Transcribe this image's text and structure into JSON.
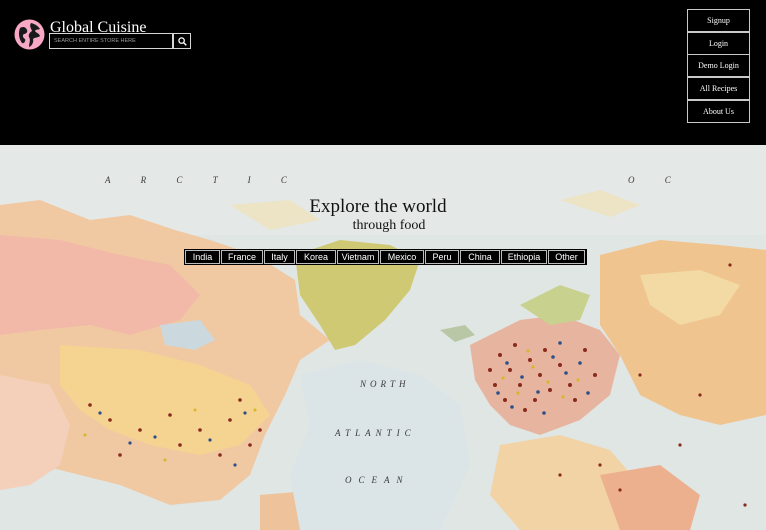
{
  "header": {
    "brand": "Global Cuisine",
    "logo_icon": "globe-icon",
    "logo_color": "#f7a8c4",
    "search": {
      "placeholder": "SEARCH ENTIRE STORE HERE",
      "button_icon": "search-icon"
    },
    "nav": [
      {
        "label": "Signup"
      },
      {
        "label": "Login"
      },
      {
        "label": "Demo Login"
      },
      {
        "label": "All Recipes"
      },
      {
        "label": "About Us"
      }
    ]
  },
  "hero": {
    "title": "Explore the world",
    "subtitle": "through food",
    "countries": [
      "India",
      "France",
      "Italy",
      "Korea",
      "Vietnam",
      "Mexico",
      "Peru",
      "China",
      "Ethiopia",
      "Other"
    ],
    "map_labels": {
      "arctic": "A R C T I C",
      "ocean_top": "O C",
      "north": "NORTH",
      "atlantic": "ATLANTIC",
      "ocean": "OCEAN"
    }
  }
}
